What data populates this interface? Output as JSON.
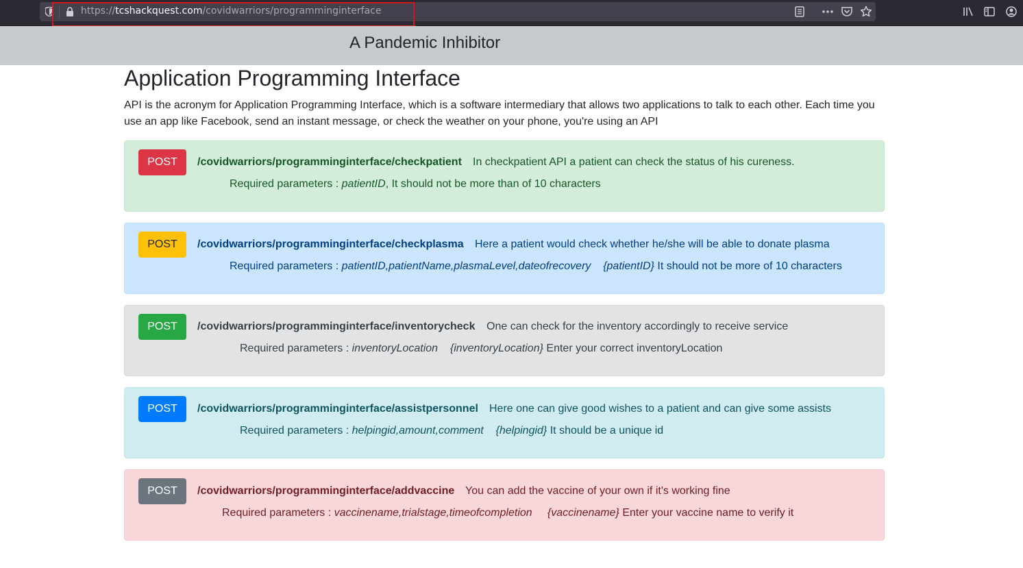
{
  "browser": {
    "url_scheme": "https://",
    "url_host": "tcshackquest.com",
    "url_path": "/covidwarriors/programminginterface",
    "icons": [
      "shield-icon",
      "lock-icon",
      "reader-view-icon",
      "more-icon",
      "pocket-icon",
      "bookmark-star-icon",
      "library-icon",
      "sidebar-icon",
      "account-icon"
    ]
  },
  "header": {
    "title": "A Pandemic Inhibitor"
  },
  "page": {
    "heading": "Application Programming Interface",
    "intro": "API is the acronym for Application Programming Interface, which is a software intermediary that allows two applications to talk to each other. Each time you use an app like Facebook, send an instant message, or check the weather on your phone, you're using an API"
  },
  "colors": {
    "success_bg": "#d4edda",
    "info_bg": "#cce5ff",
    "secondary_bg": "#e2e3e5",
    "teal_bg": "#d1ecf1",
    "danger_bg": "#f8d7da",
    "badge_red": "#dc3545",
    "badge_yellow": "#ffc107",
    "badge_green": "#28a745",
    "badge_blue": "#007bff",
    "badge_gray": "#6c757d"
  },
  "endpoints": [
    {
      "method": "POST",
      "path": "/covidwarriors/programminginterface/checkpatient",
      "description": "In checkpatient API a patient can check the status of his cureness.",
      "params_label": "Required parameters :",
      "params": "patientID",
      "param_hint": "",
      "note": ", It should not be more than of 10 characters"
    },
    {
      "method": "POST",
      "path": "/covidwarriors/programminginterface/checkplasma",
      "description": "Here a patient would check whether he/she will be able to donate plasma",
      "params_label": "Required parameters :",
      "params": "patientID,patientName,plasmaLevel,dateofrecovery",
      "param_hint": "{patientID}",
      "note": "It should not be more of 10 characters"
    },
    {
      "method": "POST",
      "path": "/covidwarriors/programminginterface/inventorycheck",
      "description": "One can check for the inventory accordingly to receive service",
      "params_label": "Required parameters :",
      "params": "inventoryLocation",
      "param_hint": "{inventoryLocation}",
      "note": "Enter your correct inventoryLocation"
    },
    {
      "method": "POST",
      "path": "/covidwarriors/programminginterface/assistpersonnel",
      "description": "Here one can give good wishes to a patient and can give some assists",
      "params_label": "Required parameters :",
      "params": "helpingid,amount,comment",
      "param_hint": "{helpingid}",
      "note": "It should be a unique id"
    },
    {
      "method": "POST",
      "path": "/covidwarriors/programminginterface/addvaccine",
      "description": "You can add the vaccine of your own if it's working fine",
      "params_label": "Required parameters :",
      "params": "vaccinename,trialstage,timeofcompletion",
      "param_hint": "{vaccinename}",
      "note": "Enter your vaccine name to verify it"
    }
  ]
}
